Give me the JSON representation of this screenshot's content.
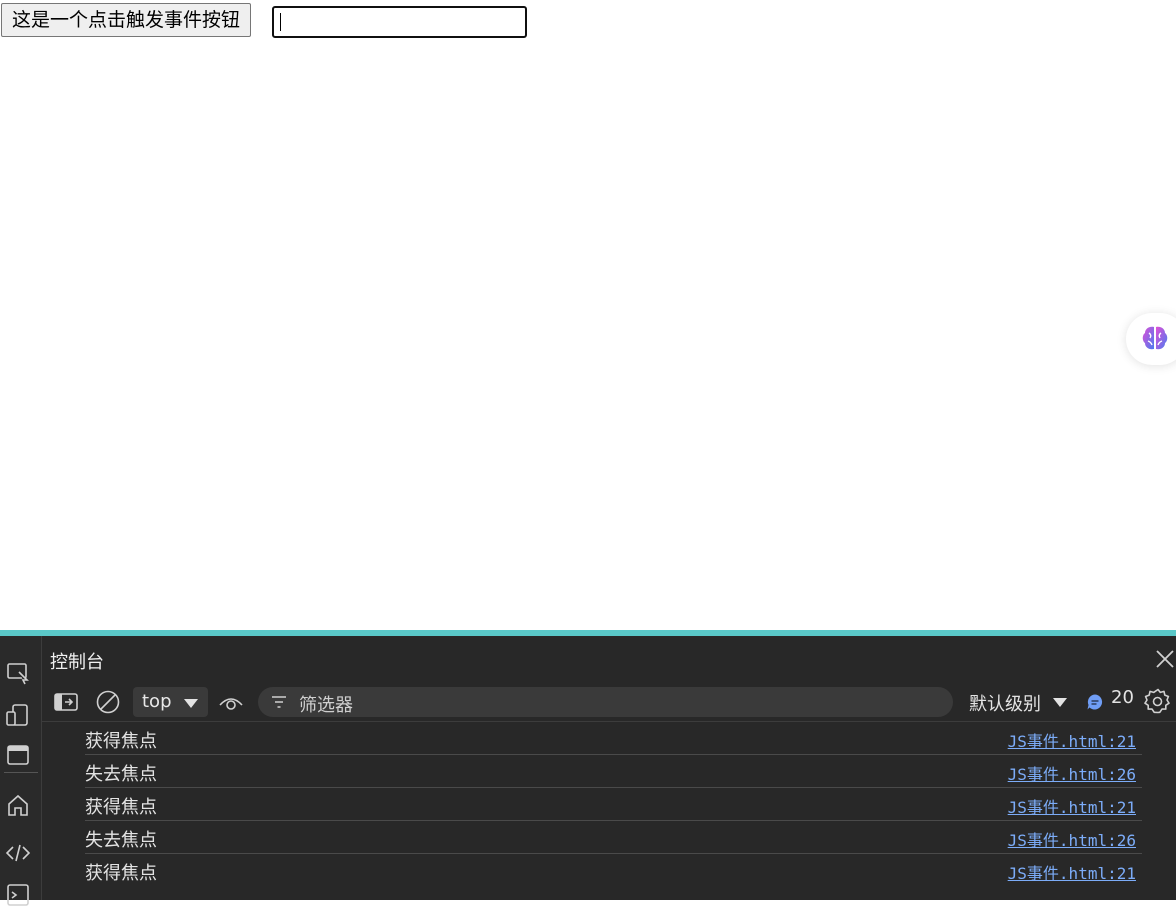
{
  "page": {
    "button_label": "这是一个点击触发事件按钮",
    "input_value": ""
  },
  "devtools": {
    "panel_title": "控制台",
    "toolbar": {
      "context": "top",
      "filter_placeholder": "筛选器",
      "level": "默认级别",
      "message_count": "20"
    },
    "logs": [
      {
        "text": "获得焦点",
        "source": "JS事件.html:21"
      },
      {
        "text": "失去焦点",
        "source": "JS事件.html:26"
      },
      {
        "text": "获得焦点",
        "source": "JS事件.html:21"
      },
      {
        "text": "失去焦点",
        "source": "JS事件.html:26"
      },
      {
        "text": "获得焦点",
        "source": "JS事件.html:21"
      }
    ]
  },
  "colors": {
    "accent": "#5ac8c8",
    "devtools_bg": "#282828",
    "link": "#7cacf8"
  }
}
